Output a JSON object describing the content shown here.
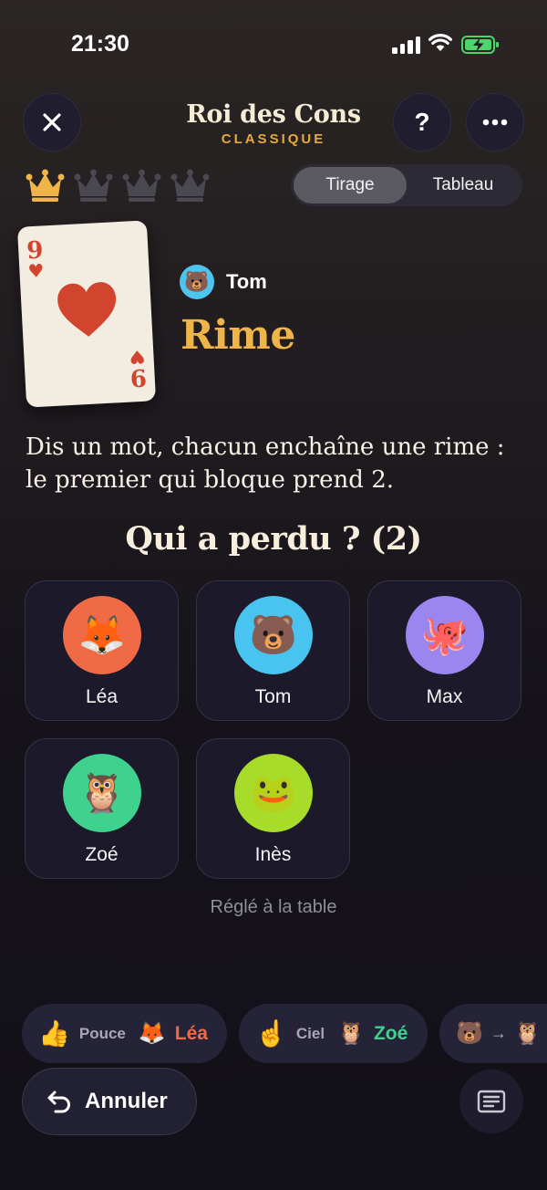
{
  "status": {
    "time": "21:30"
  },
  "header": {
    "title": "Roi des Cons",
    "mode": "CLASSIQUE",
    "close_icon": "close-icon",
    "help_label": "?",
    "more_icon": "ellipsis-icon"
  },
  "crowns": {
    "total": 4,
    "earned": 1,
    "active_color": "#f0b548",
    "inactive_color": "#4a4850"
  },
  "tabs": {
    "draw": "Tirage",
    "board": "Tableau",
    "active": "Tirage"
  },
  "card": {
    "rank": "9",
    "suit": "♥",
    "suit_color": "#d1452f"
  },
  "turn": {
    "player_name": "Tom",
    "player_emoji": "🐻",
    "challenge": "Rime"
  },
  "rule": {
    "line1": "Dis un mot, chacun enchaîne une rime :",
    "line2": "le premier qui bloque prend 2."
  },
  "question": "Qui a perdu ? (2)",
  "players": [
    {
      "name": "Léa",
      "emoji": "🦊",
      "color": "#f06a45"
    },
    {
      "name": "Tom",
      "emoji": "🐻",
      "color": "#49c3ef"
    },
    {
      "name": "Max",
      "emoji": "🐙",
      "color": "#9a86ee"
    },
    {
      "name": "Zoé",
      "emoji": "🦉",
      "color": "#3ed28e"
    },
    {
      "name": "Inès",
      "emoji": "🐸",
      "color": "#a8dc2a"
    }
  ],
  "settled_note": "Réglé à la table",
  "history": [
    {
      "emoji": "👍",
      "label": "Pouce",
      "player_emoji": "🦊",
      "player": "Léa",
      "color": "#f06a45"
    },
    {
      "emoji": "☝️",
      "label": "Ciel",
      "player_emoji": "🦉",
      "player": "Zoé",
      "color": "#3ed28e"
    },
    {
      "from_emoji": "🐻",
      "arrow": "→",
      "to_emoji": "🦉"
    }
  ],
  "undo_label": "Annuler",
  "log_icon": "log-icon"
}
